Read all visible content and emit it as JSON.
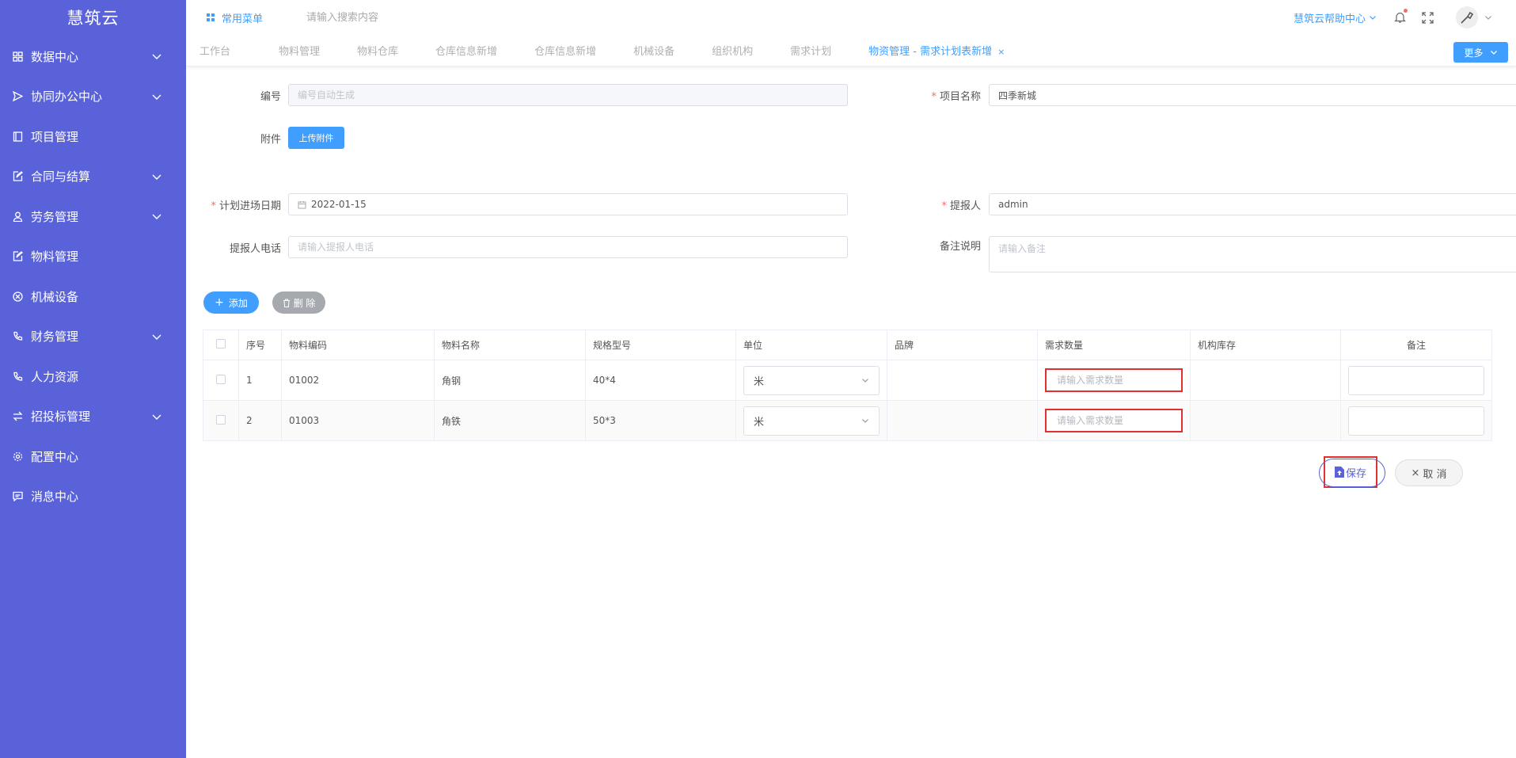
{
  "sidebar": {
    "logo": "慧筑云",
    "items": [
      {
        "label": "数据中心",
        "icon": "grid-icon",
        "expandable": true
      },
      {
        "label": "协同办公中心",
        "icon": "send-icon",
        "expandable": true
      },
      {
        "label": "项目管理",
        "icon": "book-icon",
        "expandable": false
      },
      {
        "label": "合同与结算",
        "icon": "edit-doc-icon",
        "expandable": true
      },
      {
        "label": "劳务管理",
        "icon": "worker-icon",
        "expandable": true
      },
      {
        "label": "物料管理",
        "icon": "edit-doc-icon",
        "expandable": false
      },
      {
        "label": "机械设备",
        "icon": "circle-x-icon",
        "expandable": false
      },
      {
        "label": "财务管理",
        "icon": "phone-icon",
        "expandable": true
      },
      {
        "label": "人力资源",
        "icon": "phone-icon",
        "expandable": false
      },
      {
        "label": "招投标管理",
        "icon": "transfer-icon",
        "expandable": true
      },
      {
        "label": "配置中心",
        "icon": "gear-icon",
        "expandable": false
      },
      {
        "label": "消息中心",
        "icon": "message-icon",
        "expandable": false
      }
    ]
  },
  "header": {
    "common_menu": "常用菜单",
    "search_placeholder": "请输入搜索内容",
    "help": "慧筑云帮助中心"
  },
  "tabs": {
    "items": [
      {
        "label": "工作台",
        "active": false
      },
      {
        "label": "物料管理",
        "active": false
      },
      {
        "label": "物料仓库",
        "active": false
      },
      {
        "label": "仓库信息新增",
        "active": false
      },
      {
        "label": "仓库信息新增",
        "active": false
      },
      {
        "label": "机械设备",
        "active": false
      },
      {
        "label": "组织机构",
        "active": false
      },
      {
        "label": "需求计划",
        "active": false
      },
      {
        "label": "物资管理 - 需求计划表新增",
        "active": true
      }
    ],
    "close": "×",
    "more": "更多"
  },
  "form": {
    "code_label": "编号",
    "code_placeholder": "编号自动生成",
    "project_label": "项目名称",
    "project_value": "四季新城",
    "attachment_label": "附件",
    "upload_label": "上传附件",
    "date_label": "计划进场日期",
    "date_value": "2022-01-15",
    "submitter_label": "提报人",
    "submitter_value": "admin",
    "phone_label": "提报人电话",
    "phone_placeholder": "请输入提报人电话",
    "remark_label": "备注说明",
    "remark_placeholder": "请输入备注"
  },
  "actions": {
    "add": "添加",
    "delete": "删 除",
    "save": "保存",
    "cancel": "取 消"
  },
  "table": {
    "headers": [
      "序号",
      "物料编码",
      "物料名称",
      "规格型号",
      "单位",
      "品牌",
      "需求数量",
      "机构库存",
      "备注"
    ],
    "qty_placeholder": "请输入需求数量",
    "rows": [
      {
        "index": "1",
        "code": "01002",
        "name": "角钢",
        "spec": "40*4",
        "unit": "米",
        "brand": "",
        "stock": ""
      },
      {
        "index": "2",
        "code": "01003",
        "name": "角铁",
        "spec": "50*3",
        "unit": "米",
        "brand": "",
        "stock": ""
      }
    ]
  },
  "colors": {
    "sidebar": "#5962d9",
    "primary": "#409eff",
    "highlight": "#e03030"
  }
}
